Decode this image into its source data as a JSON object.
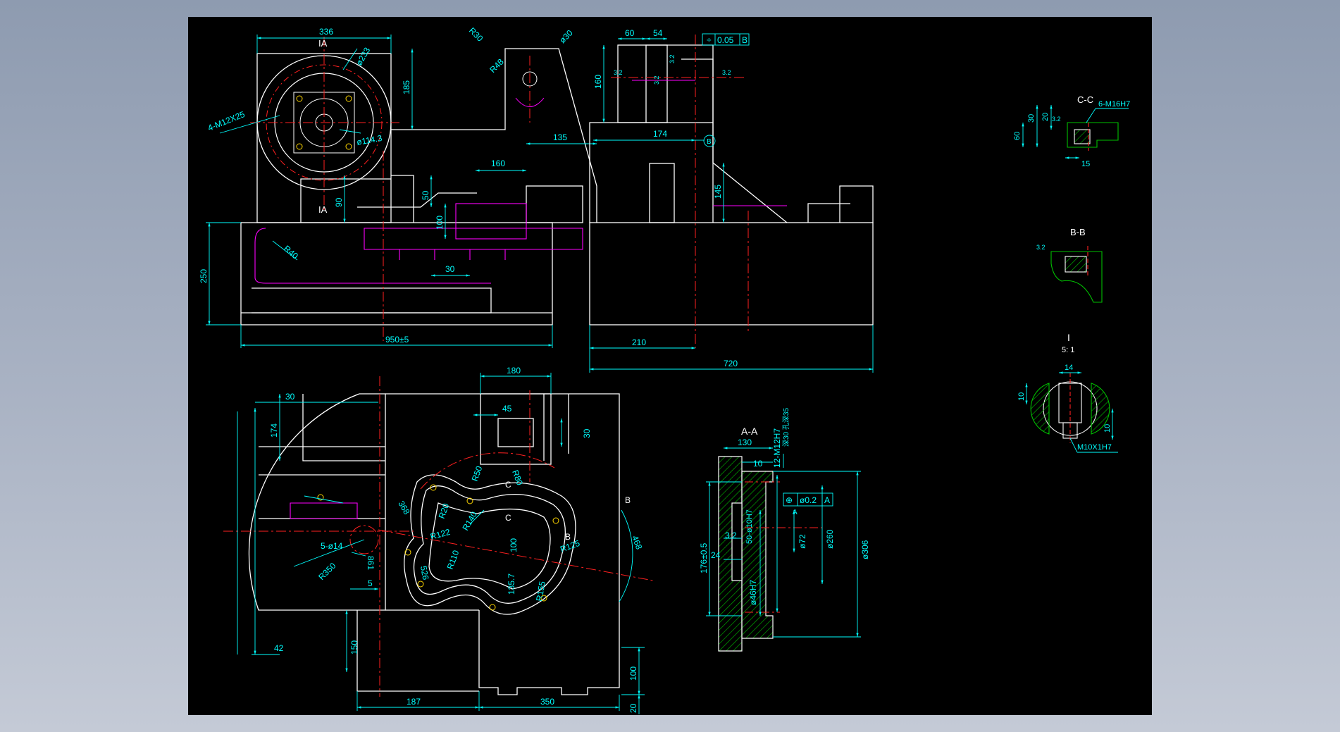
{
  "colors": {
    "background": "#000000",
    "outline": "#ffffff",
    "dimension": "#00ffff",
    "centerline": "#ff2020",
    "hidden": "#ff00ff",
    "hatch": "#00c000",
    "frame": "#8e9bb0"
  },
  "views": {
    "section_aa": "A-A",
    "section_bb": "B-B",
    "section_cc": "C-C",
    "detail_label": "I",
    "detail_scale": "5: 1",
    "mark_a_top": "IA",
    "mark_a_bottom": "IA",
    "mark_b1": "B",
    "mark_b2": "B",
    "mark_c1": "C",
    "mark_c2": "C",
    "datum_b": "B",
    "datum_a": "A"
  },
  "front_view": {
    "d336": "336",
    "r30": "R30",
    "d30": "ø30",
    "d233": "ø233",
    "d4m12": "4-M12X25",
    "d1143": "ø114.3",
    "d185": "185",
    "r48": "R48",
    "d135": "135",
    "d160": "160",
    "d90": "90",
    "d50": "50",
    "d100": "100",
    "d250": "250",
    "r40": "R40",
    "d30b": "30",
    "d950": "950±5"
  },
  "side_view": {
    "d60": "60",
    "d54": "54",
    "tol1": "0.05",
    "tolref": "B",
    "d160": "160",
    "rough1": "3.2",
    "rough2": "3.2",
    "rough3": "3.2",
    "rough4": "3.2",
    "d174": "174",
    "d145": "145",
    "d210": "210",
    "d720": "720"
  },
  "plan_view": {
    "d180": "180",
    "d30": "30",
    "d45": "45",
    "d174": "174",
    "d30b": "30",
    "r50": "R50",
    "r80": "R80",
    "r20": "R20",
    "d368": "368",
    "r140": "R140",
    "r122": "R122",
    "d5phi14": "5-ø14",
    "r110": "R110",
    "d526": "526",
    "d100": "100",
    "r125": "R125",
    "d468": "468",
    "r350": "R350",
    "d861": "861",
    "d5": "5",
    "d1357": "135.7",
    "r155": "R155",
    "d150": "150",
    "d42": "42",
    "d187": "187",
    "d350": "350",
    "d100b": "100",
    "d20": "20"
  },
  "section_aa_dims": {
    "d130": "130",
    "d10": "10",
    "note_m12": "12-M12H7",
    "note_deep": "深30 孔深35",
    "phi10h7": "50-ø10H7",
    "tol_symbol": "⊕",
    "tol_val": "ø0.2",
    "tol_ref": "A",
    "d176": "176±0.5",
    "d32": "3.2",
    "d24": "24",
    "phi72": "ø72",
    "phi260": "ø260",
    "phi306": "ø306",
    "phi46": "ø46H7"
  },
  "section_cc_dims": {
    "d30": "30",
    "d20": "20",
    "d60": "60",
    "rough": "3.2",
    "d15": "15",
    "m16": "6-M16H7"
  },
  "section_bb_dims": {
    "rough": "3.2"
  },
  "detail_dims": {
    "d14": "14",
    "d10a": "10",
    "d10b": "10",
    "m10": "M10X1H7"
  }
}
